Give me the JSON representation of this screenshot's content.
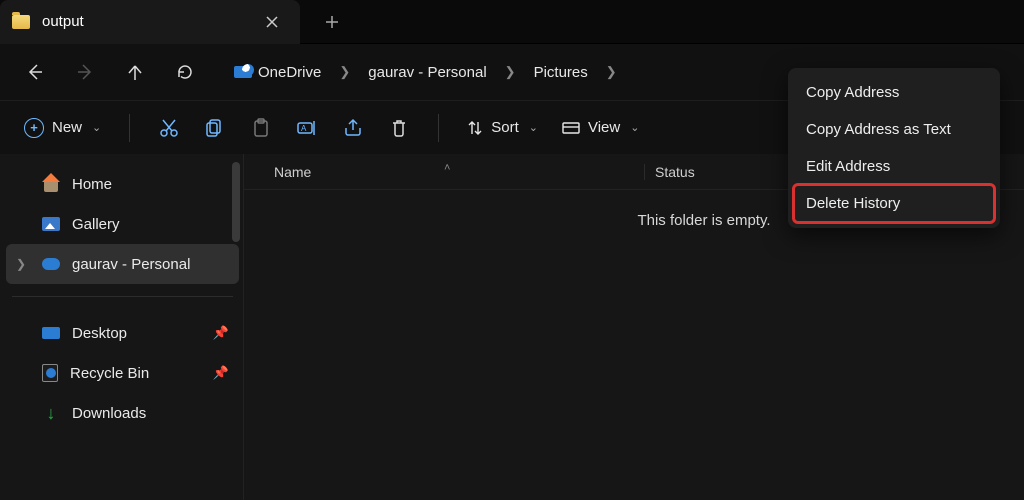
{
  "tab": {
    "title": "output"
  },
  "breadcrumb": {
    "items": [
      {
        "label": "OneDrive"
      },
      {
        "label": "gaurav - Personal"
      },
      {
        "label": "Pictures"
      }
    ]
  },
  "toolbar": {
    "new_label": "New",
    "sort_label": "Sort",
    "view_label": "View"
  },
  "sidebar": {
    "home": "Home",
    "gallery": "Gallery",
    "personal": "gaurav - Personal",
    "desktop": "Desktop",
    "recycle": "Recycle Bin",
    "downloads": "Downloads"
  },
  "columns": {
    "name": "Name",
    "status": "Status"
  },
  "empty_text": "This folder is empty.",
  "context_menu": {
    "items": [
      "Copy Address",
      "Copy Address as Text",
      "Edit Address",
      "Delete History"
    ],
    "highlighted_index": 3
  }
}
